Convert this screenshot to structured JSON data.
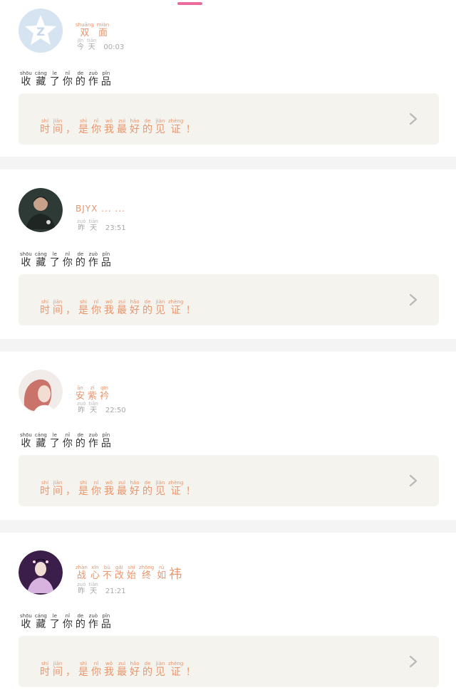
{
  "posts": [
    {
      "user": {
        "avatar": "qq-star-logo",
        "name": [
          {
            "py": "shuāng",
            "hz": "双"
          },
          {
            "py": "miàn",
            "hz": "面"
          }
        ]
      },
      "time": {
        "day": [
          {
            "py": "jīn",
            "hz": "今"
          },
          {
            "py": "tiān",
            "hz": "天"
          }
        ],
        "clock": "00:03"
      },
      "action": [
        {
          "py": "shōu",
          "hz": "收"
        },
        {
          "py": "cáng",
          "hz": "藏"
        },
        {
          "py": "le",
          "hz": "了"
        },
        {
          "py": "nǐ",
          "hz": "你"
        },
        {
          "py": "de",
          "hz": "的"
        },
        {
          "py": "zuò",
          "hz": "作"
        },
        {
          "py": "pǐn",
          "hz": "品"
        }
      ],
      "quote": [
        {
          "py": "shí",
          "hz": "时"
        },
        {
          "py": "jiān",
          "hz": "间"
        },
        {
          "py": "",
          "hz": "，"
        },
        {
          "py": "shì",
          "hz": "是"
        },
        {
          "py": "nǐ",
          "hz": "你"
        },
        {
          "py": "wǒ",
          "hz": "我"
        },
        {
          "py": "zuì",
          "hz": "最"
        },
        {
          "py": "hǎo",
          "hz": "好"
        },
        {
          "py": "de",
          "hz": "的"
        },
        {
          "py": "jiàn",
          "hz": "见"
        },
        {
          "py": "zhèng",
          "hz": "证"
        },
        {
          "py": "",
          "hz": "!"
        }
      ]
    },
    {
      "user": {
        "avatar": "male-portrait",
        "latin_name": "BJYX ... ..."
      },
      "time": {
        "day": [
          {
            "py": "zuó",
            "hz": "昨"
          },
          {
            "py": "tiān",
            "hz": "天"
          }
        ],
        "clock": "23:51"
      },
      "action": [
        {
          "py": "shōu",
          "hz": "收"
        },
        {
          "py": "cáng",
          "hz": "藏"
        },
        {
          "py": "le",
          "hz": "了"
        },
        {
          "py": "nǐ",
          "hz": "你"
        },
        {
          "py": "de",
          "hz": "的"
        },
        {
          "py": "zuò",
          "hz": "作"
        },
        {
          "py": "pǐn",
          "hz": "品"
        }
      ],
      "quote": [
        {
          "py": "shí",
          "hz": "时"
        },
        {
          "py": "jiān",
          "hz": "间"
        },
        {
          "py": "",
          "hz": "，"
        },
        {
          "py": "shì",
          "hz": "是"
        },
        {
          "py": "nǐ",
          "hz": "你"
        },
        {
          "py": "wǒ",
          "hz": "我"
        },
        {
          "py": "zuì",
          "hz": "最"
        },
        {
          "py": "hǎo",
          "hz": "好"
        },
        {
          "py": "de",
          "hz": "的"
        },
        {
          "py": "jiàn",
          "hz": "见"
        },
        {
          "py": "zhèng",
          "hz": "证"
        },
        {
          "py": "",
          "hz": "!"
        }
      ]
    },
    {
      "user": {
        "avatar": "red-hair-portrait",
        "name": [
          {
            "py": "ān",
            "hz": "安"
          },
          {
            "py": "zǐ",
            "hz": "紫"
          },
          {
            "py": "qīn",
            "hz": "衿"
          }
        ]
      },
      "time": {
        "day": [
          {
            "py": "zuó",
            "hz": "昨"
          },
          {
            "py": "tiān",
            "hz": "天"
          }
        ],
        "clock": "22:50"
      },
      "action": [
        {
          "py": "shōu",
          "hz": "收"
        },
        {
          "py": "cáng",
          "hz": "藏"
        },
        {
          "py": "le",
          "hz": "了"
        },
        {
          "py": "nǐ",
          "hz": "你"
        },
        {
          "py": "de",
          "hz": "的"
        },
        {
          "py": "zuò",
          "hz": "作"
        },
        {
          "py": "pǐn",
          "hz": "品"
        }
      ],
      "quote": [
        {
          "py": "shí",
          "hz": "时"
        },
        {
          "py": "jiān",
          "hz": "间"
        },
        {
          "py": "",
          "hz": "，"
        },
        {
          "py": "shì",
          "hz": "是"
        },
        {
          "py": "nǐ",
          "hz": "你"
        },
        {
          "py": "wǒ",
          "hz": "我"
        },
        {
          "py": "zuì",
          "hz": "最"
        },
        {
          "py": "hǎo",
          "hz": "好"
        },
        {
          "py": "de",
          "hz": "的"
        },
        {
          "py": "jiàn",
          "hz": "见"
        },
        {
          "py": "zhèng",
          "hz": "证"
        },
        {
          "py": "",
          "hz": "!"
        }
      ]
    },
    {
      "user": {
        "avatar": "costume-portrait",
        "name": [
          {
            "py": "zhàn",
            "hz": "战"
          },
          {
            "py": "xīn",
            "hz": "心"
          },
          {
            "py": "bù",
            "hz": "不"
          },
          {
            "py": "gǎi",
            "hz": "改"
          },
          {
            "py": "shǐ",
            "hz": "始"
          },
          {
            "py": "zhōng",
            "hz": "终"
          },
          {
            "py": "rú",
            "hz": "如"
          },
          {
            "py": "",
            "hz": "祎"
          }
        ]
      },
      "time": {
        "day": [
          {
            "py": "zuó",
            "hz": "昨"
          },
          {
            "py": "tiān",
            "hz": "天"
          }
        ],
        "clock": "21:21"
      },
      "action": [
        {
          "py": "shōu",
          "hz": "收"
        },
        {
          "py": "cáng",
          "hz": "藏"
        },
        {
          "py": "le",
          "hz": "了"
        },
        {
          "py": "nǐ",
          "hz": "你"
        },
        {
          "py": "de",
          "hz": "的"
        },
        {
          "py": "zuò",
          "hz": "作"
        },
        {
          "py": "pǐn",
          "hz": "品"
        }
      ],
      "quote": [
        {
          "py": "shí",
          "hz": "时"
        },
        {
          "py": "jiān",
          "hz": "间"
        },
        {
          "py": "",
          "hz": "，"
        },
        {
          "py": "shì",
          "hz": "是"
        },
        {
          "py": "nǐ",
          "hz": "你"
        },
        {
          "py": "wǒ",
          "hz": "我"
        },
        {
          "py": "zuì",
          "hz": "最"
        },
        {
          "py": "hǎo",
          "hz": "好"
        },
        {
          "py": "de",
          "hz": "的"
        },
        {
          "py": "jiàn",
          "hz": "见"
        },
        {
          "py": "zhèng",
          "hz": "证"
        },
        {
          "py": "",
          "hz": "!"
        }
      ]
    }
  ],
  "colors": {
    "accent": "#e8956c",
    "indicator": "#ec6a9c",
    "quote_bg": "#f4f3ee",
    "divider": "#f4f4f4"
  }
}
